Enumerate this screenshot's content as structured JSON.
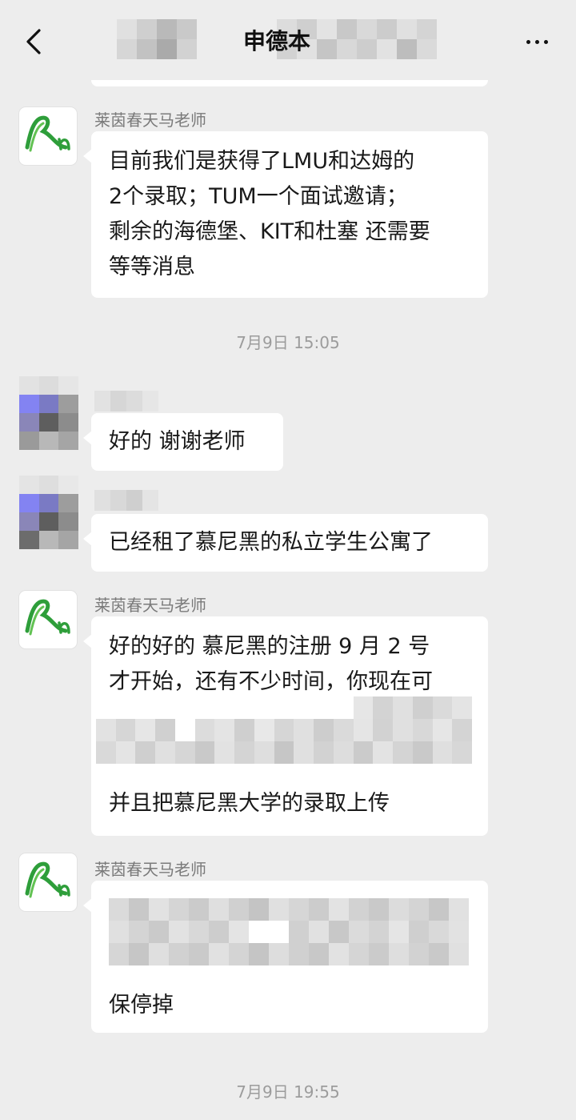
{
  "header": {
    "title": "申德本"
  },
  "icons": {
    "back": "chevron-left-icon",
    "more": "more-dots-icon",
    "teacher_avatar": "rn-logo-icon"
  },
  "colors": {
    "background": "#ededed",
    "bubble": "#ffffff",
    "logo_green": "#2e9e3a"
  },
  "messages": [
    {
      "sender": "莱茵春天马老师",
      "text": "目前我们是获得了LMU和达姆的\n2个录取；TUM一个面试邀请；\n剩余的海德堡、KIT和杜塞 还需要\n等等消息"
    },
    {
      "time": "7月9日 15:05"
    },
    {
      "text": "好的 谢谢老师"
    },
    {
      "text": "已经租了慕尼黑的私立学生公寓了"
    },
    {
      "sender": "莱茵春天马老师",
      "text_before": "好的好的 慕尼黑的注册 9 月 2 号\n才开始，还有不少时间，你现在可\n以先准备一下保险，",
      "text_after": "并且把慕尼黑大学的录取上传"
    },
    {
      "sender": "莱茵春天马老师",
      "text": "保停掉"
    },
    {
      "time": "7月9日 19:55"
    }
  ]
}
